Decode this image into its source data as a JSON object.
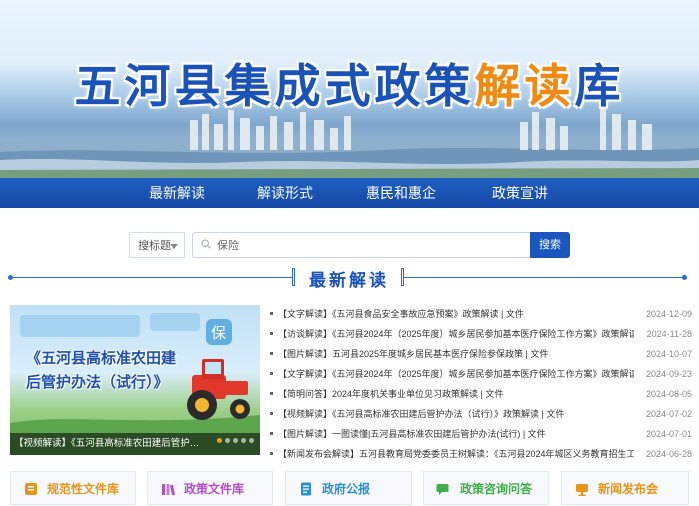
{
  "banner": {
    "title_main": "五河县集成式政策",
    "title_highlight": "解读",
    "title_tail": "库"
  },
  "nav": {
    "items": [
      "最新解读",
      "解读形式",
      "惠民和惠企",
      "政策宣讲"
    ]
  },
  "search": {
    "select_label": "搜标题",
    "input_value": "保险",
    "button_label": "搜索"
  },
  "section": {
    "title": "最新解读"
  },
  "feature": {
    "poster_title": "《五河县高标准农田建后管护办法（试行）》",
    "caption": "【视频解读】《五河县高标准农田建后管护办..."
  },
  "news": [
    {
      "title": "【文字解读】《五河县食品安全事故应急预案》政策解读 | 文件",
      "date": "2024-12-09"
    },
    {
      "title": "【访谈解读】《五河县2024年（2025年度）城乡居民参加基本医疗保险工作方案》政策解读 | 文件",
      "date": "2024-11-28"
    },
    {
      "title": "【图片解读】五河县2025年度城乡居民基本医疗保险参保政策 | 文件",
      "date": "2024-10-07"
    },
    {
      "title": "【文字解读】《五河县2024年（2025年度）城乡居民参加基本医疗保险工作方案》政策解读 | 文件",
      "date": "2024-09-23"
    },
    {
      "title": "【简明问答】2024年度机关事业单位见习政策解读 | 文件",
      "date": "2024-08-05"
    },
    {
      "title": "【视频解读】《五河县高标准农田建后管护办法（试行）》政策解读 | 文件",
      "date": "2024-07-02"
    },
    {
      "title": "【图片解读】一图读懂|五河县高标准农田建后管护办法(试行) | 文件",
      "date": "2024-07-01"
    },
    {
      "title": "【新闻发布会解读】五河县教育局党委委员王树解读：《五河县2024年城区义务教育招生工...  | 文件",
      "date": "2024-06-28"
    }
  ],
  "tiles": [
    {
      "label": "规范性文件库",
      "icon": "document-library-icon",
      "color": "#e6941a"
    },
    {
      "label": "政策文件库",
      "icon": "books-icon",
      "color": "#b24fc4"
    },
    {
      "label": "政府公报",
      "icon": "bulletin-icon",
      "color": "#2b8fd6"
    },
    {
      "label": "政策咨询问答",
      "icon": "chat-icon",
      "color": "#3fae4a"
    },
    {
      "label": "新闻发布会",
      "icon": "press-conference-icon",
      "color": "#e6941a"
    }
  ],
  "colors": {
    "primary": "#1a56bd",
    "nav_bg": "#1648a5",
    "title_blue": "#1a52b8",
    "title_orange": "#f08a12"
  }
}
